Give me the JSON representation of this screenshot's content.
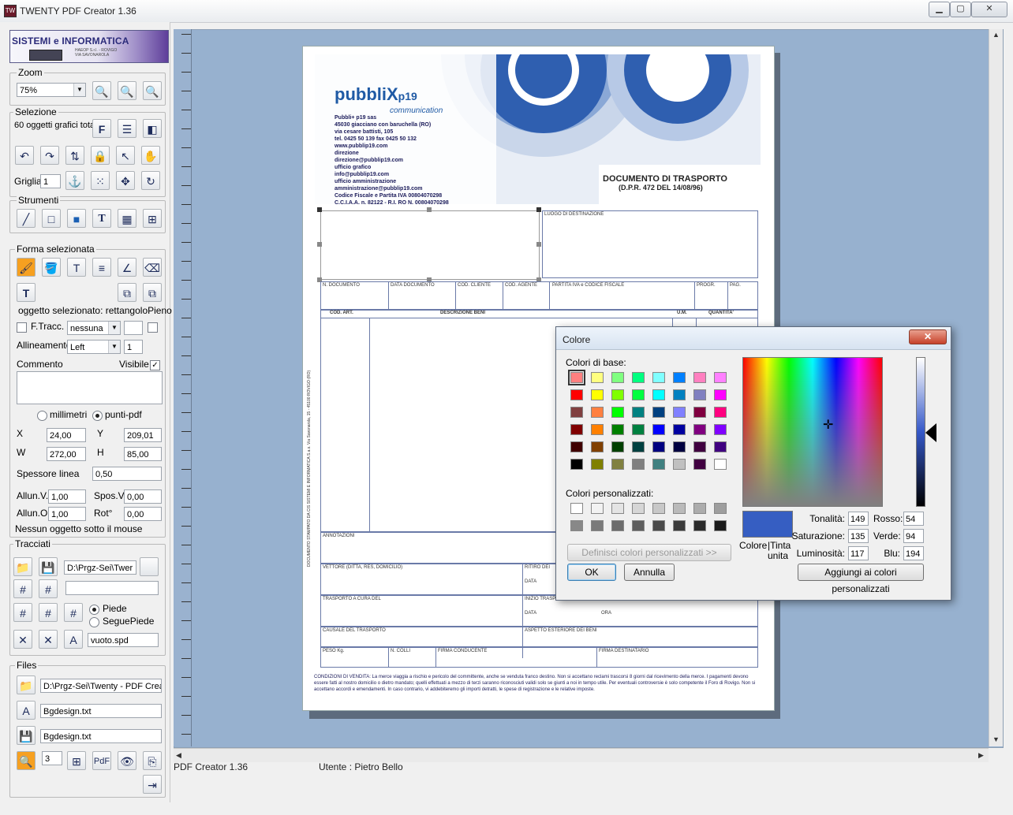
{
  "window": {
    "title": "TWENTY  PDF Creator 1.36",
    "min": "▁",
    "max": "▢",
    "close": "✕"
  },
  "logo": {
    "title": "SISTEMI e INFORMATICA",
    "sub": "HAEOP S.r.l. - ROVIGO VIA SAVONAROLA"
  },
  "zoom": {
    "label": "Zoom",
    "value": "75%"
  },
  "selezione": {
    "label": "Selezione",
    "count_text": "60 oggetti grafici tota",
    "griglia_label": "Griglia:",
    "griglia_value": "1"
  },
  "strumenti": {
    "label": "Strumenti"
  },
  "forma": {
    "label": "Forma selezionata",
    "selected_text": "oggetto selezionato: rettangoloPieno",
    "ftracc_label": "F.Tracc.",
    "ftracc_value": "nessuna",
    "allineamento_label": "Allineamento:",
    "allineamento_value": "Left",
    "allineamento_num": "1",
    "commento_label": "Commento",
    "visibile_label": "Visibile",
    "visibile_check": "✓",
    "unit_mm": "millimetri",
    "unit_pdf": "punti-pdf",
    "x_label": "X",
    "x_value": "24,00",
    "y_label": "Y",
    "y_value": "209,01",
    "w_label": "W",
    "w_value": "272,00",
    "h_label": "H",
    "h_value": "85,00",
    "spessore_label": "Spessore linea",
    "spessore_value": "0,50",
    "allunv_label": "Allun.V.",
    "allunv_value": "1,00",
    "sposv_label": "Spos.V.",
    "sposv_value": "0,00",
    "alluno_label": "Allun.O.",
    "alluno_value": "1,00",
    "rot_label": "Rot°",
    "rot_value": "0,00",
    "mouse_text": "Nessun oggetto sotto il mouse"
  },
  "tracciati": {
    "label": "Tracciati",
    "path_value": "D:\\Prgz-Sei\\Twer",
    "piede_label": "Piede",
    "seguepiede_label": "SeguePiede",
    "file_value": "vuoto.spd"
  },
  "files": {
    "label": "Files",
    "path_value": "D:\\Prgz-Sei\\Twenty - PDF Crea",
    "file1": "Bgdesign.txt",
    "file2": "Bgdesign.txt",
    "num": "3"
  },
  "status": {
    "version": "PDF Creator 1.36",
    "user": "Utente : Pietro Bello"
  },
  "document": {
    "title": "DOCUMENTO DI TRASPORTO",
    "subtitle": "(D.P.R. 472 DEL 14/08/96)",
    "brand": "pubbliX",
    "brand_suffix": "p19",
    "brand_sub": "communication",
    "address_lines": [
      "Pubbli+ p19 sas",
      "45030 giacciano con baruchella (RO)",
      "via cesare battisti, 105",
      "tel. 0425 50 139  fax 0425 50 132",
      "www.pubblip19.com",
      "direzione",
      "direzione@pubblip19.com",
      "ufficio grafico",
      "info@pubblip19.com",
      "ufficio amministrazione",
      "amministrazione@pubblip19.com",
      "Codice Fiscale e Partita IVA 00804070298",
      "C.C.I.A.A. n. 82122 - R.I. RO N. 00804070298"
    ],
    "luogo": "LUOGO DI DESTINAZIONE",
    "cols": [
      "N. DOCUMENTO",
      "DATA DOCUMENTO",
      "COD. CLIENTE",
      "COD. AGENTE",
      "PARTITA IVA e CODICE FISCALE",
      "PROGR.",
      "PAG."
    ],
    "items_header": [
      "COD. ART.",
      "DESCRIZIONE BENI",
      "U.M.",
      "QUANTITA'"
    ],
    "annotazioni": "ANNOTAZIONI",
    "vettore": "VETTORE (DITTA, RES, DOMICILIO)",
    "ritiro": "RITIRO DEI",
    "data": "DATA",
    "trasporto": "TRASPORTO A CURA DEL",
    "inizio": "INIZIO TRASP",
    "ora": "ORA",
    "causale": "CAUSALE DEL TRASPORTO",
    "aspetto": "ASPETTO ESTERIORE DEI BENI",
    "peso": "PESO Kg.",
    "colli": "N. COLLI",
    "firma_cond": "FIRMA CONDUCENTE",
    "firma_dest": "FIRMA DESTINATARIO",
    "side_text": "DOCUMENTO STAMPATO DA CIS SISTEMI E INFORMATICA S.a.s. Via Savonarola, 15 - 45100 ROVIGO (RO)",
    "footnote": "CONDIZIONI DI VENDITA: La merce viaggia a rischio e pericolo del committente, anche se venduta franco destino. Non si accettano reclami trascorsi 8 giorni dal ricevimento della merce. I pagamenti devono essere fatti al nostro domicilio o dietro mandato; quelli effettuati a mezzo di terzi saranno riconosciuti validi solo se giunti a noi in tempo utile. Per eventuali controversie è solo competente il Foro di Rovigo. Non si accettano accordi e emendamenti. In caso contrario, vi addebiteremo gli importi detratti, le spese di registrazione e le relative imposte."
  },
  "dialog": {
    "title": "Colore",
    "close": "✕",
    "basic_label": "Colori di base:",
    "custom_label": "Colori personalizzati:",
    "define_button": "Definisci colori personalizzati >>",
    "ok": "OK",
    "cancel": "Annulla",
    "add_button": "Aggiungi ai colori personalizzati",
    "colore_label": "Colore",
    "tinta_label": "|Tinta",
    "unita_label": "unita",
    "tonalita_label": "Tonalità:",
    "tonalita": "149",
    "saturazione_label": "Saturazione:",
    "saturazione": "135",
    "luminosita_label": "Luminosità:",
    "luminosita": "117",
    "rosso_label": "Rosso:",
    "rosso": "54",
    "verde_label": "Verde:",
    "verde": "94",
    "blu_label": "Blu:",
    "blu": "194",
    "current_color": "#365ec2",
    "basic_colors": [
      "#ff8080",
      "#ffff80",
      "#80ff80",
      "#00ff80",
      "#80ffff",
      "#0080ff",
      "#ff80c0",
      "#ff80ff",
      "#ff0000",
      "#ffff00",
      "#80ff00",
      "#00ff40",
      "#00ffff",
      "#0080c0",
      "#8080c0",
      "#ff00ff",
      "#804040",
      "#ff8040",
      "#00ff00",
      "#008080",
      "#004080",
      "#8080ff",
      "#800040",
      "#ff0080",
      "#800000",
      "#ff8000",
      "#008000",
      "#008040",
      "#0000ff",
      "#0000a0",
      "#800080",
      "#8000ff",
      "#400000",
      "#804000",
      "#004000",
      "#004040",
      "#000080",
      "#000040",
      "#400040",
      "#400080",
      "#000000",
      "#808000",
      "#808040",
      "#808080",
      "#408080",
      "#c0c0c0",
      "#400040",
      "#ffffff"
    ],
    "custom_colors": [
      "#ffffff",
      "#f2f2f2",
      "#e4e4e4",
      "#d6d6d6",
      "#c8c8c8",
      "#bababa",
      "#acacac",
      "#9e9e9e",
      "#888888",
      "#7a7a7a",
      "#6c6c6c",
      "#5e5e5e",
      "#4a4a4a",
      "#3a3a3a",
      "#2a2a2a",
      "#1a1a1a"
    ]
  }
}
